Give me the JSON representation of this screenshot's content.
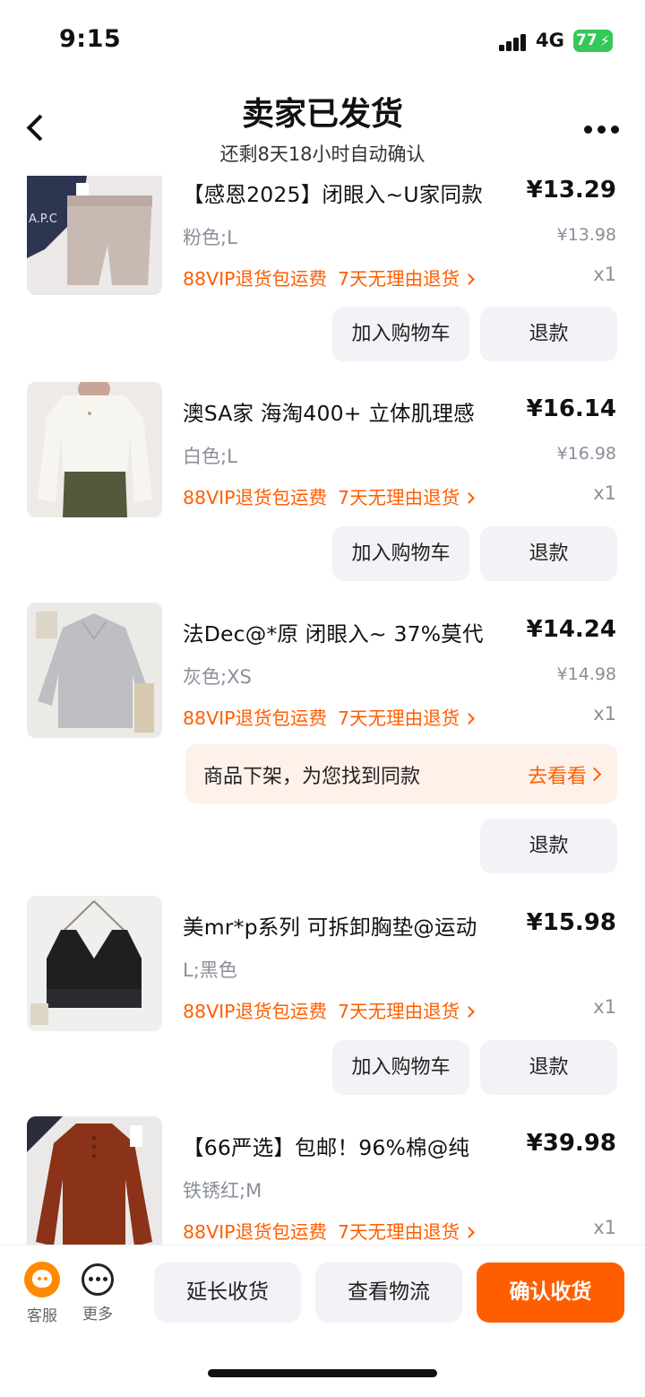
{
  "status": {
    "time": "9:15",
    "network": "4G",
    "battery": "77"
  },
  "header": {
    "title": "卖家已发货",
    "subtitle": "还剩8天18小时自动确认"
  },
  "labels": {
    "vip_return": "88VIP退货包运费",
    "seven_day": "7天无理由退货",
    "add_cart": "加入购物车",
    "refund": "退款"
  },
  "items": [
    {
      "name": "【感恩2025】闭眼入~U家同款",
      "price": "¥13.29",
      "spec": "粉色;L",
      "original": "¥13.98",
      "qty": "x1"
    },
    {
      "name": "澳SA家 海淘400+ 立体肌理感",
      "price": "¥16.14",
      "spec": "白色;L",
      "original": "¥16.98",
      "qty": "x1"
    },
    {
      "name": "法Dec@*原 闭眼入~ 37%莫代",
      "price": "¥14.24",
      "spec": "灰色;XS",
      "original": "¥14.98",
      "qty": "x1",
      "notice": {
        "text": "商品下架，为您找到同款",
        "action": "去看看"
      }
    },
    {
      "name": "美mr*p系列 可拆卸胸垫@运动",
      "price": "¥15.98",
      "spec": "L;黑色",
      "qty": "x1"
    },
    {
      "name": "【66严选】包邮！96%棉@纯",
      "price": "¥39.98",
      "spec": "铁锈红;M",
      "qty": "x1"
    }
  ],
  "bottom": {
    "service": "客服",
    "more": "更多",
    "extend": "延长收货",
    "track": "查看物流",
    "confirm": "确认收货"
  },
  "colors": {
    "accent": "#ff5e00",
    "battery": "#34c759",
    "button_bg": "#f2f3f7"
  }
}
